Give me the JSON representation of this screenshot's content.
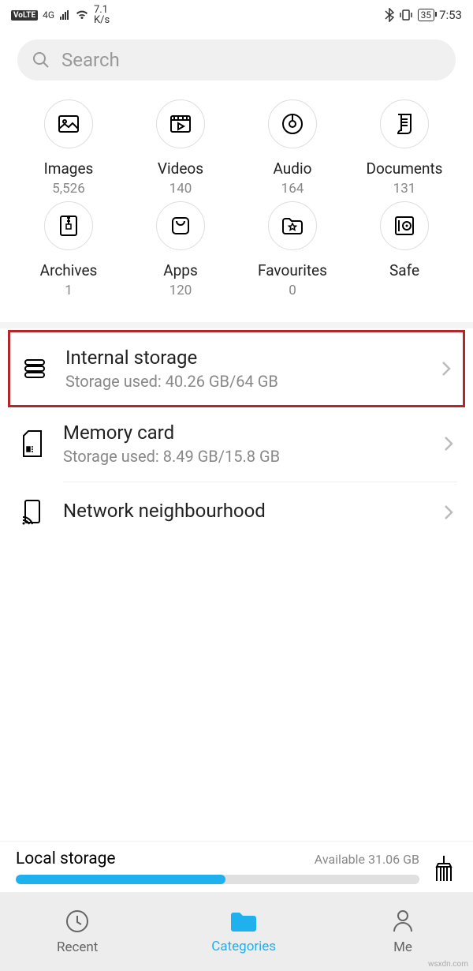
{
  "status": {
    "volte": "VoLTE",
    "net": "4G",
    "speed": "7.1",
    "speed_unit": "K/s",
    "battery": "35",
    "time": "7:53"
  },
  "search": {
    "placeholder": "Search"
  },
  "categories": [
    {
      "label": "Images",
      "count": "5,526"
    },
    {
      "label": "Videos",
      "count": "140"
    },
    {
      "label": "Audio",
      "count": "164"
    },
    {
      "label": "Documents",
      "count": "131"
    },
    {
      "label": "Archives",
      "count": "1"
    },
    {
      "label": "Apps",
      "count": "120"
    },
    {
      "label": "Favourites",
      "count": "0"
    },
    {
      "label": "Safe",
      "count": ""
    }
  ],
  "storage": {
    "internal": {
      "title": "Internal storage",
      "sub": "Storage used: 40.26 GB/64 GB"
    },
    "card": {
      "title": "Memory card",
      "sub": "Storage used: 8.49 GB/15.8 GB"
    },
    "network": {
      "title": "Network neighbourhood"
    }
  },
  "local": {
    "title": "Local storage",
    "available": "Available 31.06 GB"
  },
  "nav": {
    "recent": "Recent",
    "categories": "Categories",
    "me": "Me"
  },
  "watermark": "wsxdn.com"
}
